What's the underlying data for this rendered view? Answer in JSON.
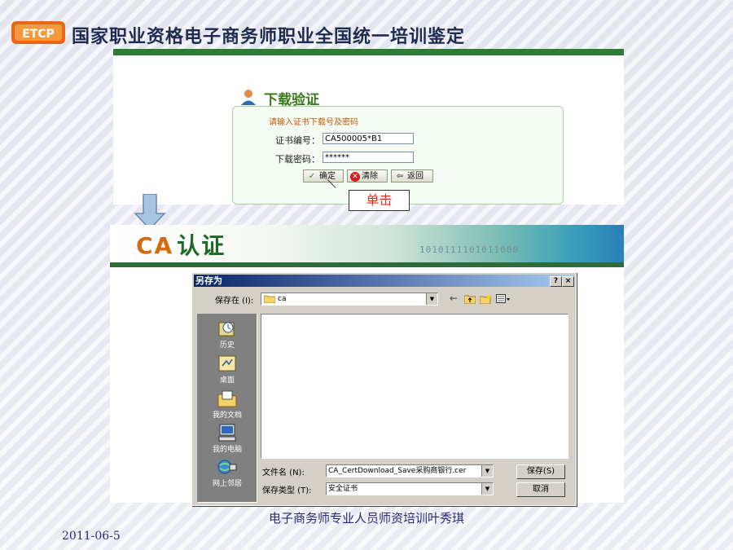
{
  "header": {
    "logo_text": "ETCP",
    "title": "国家职业资格电子商务师职业全国统一培训鉴定"
  },
  "download_panel": {
    "title": "下载验证",
    "hint": "请输入证书下载号及密码",
    "cert_label": "证书编号：",
    "cert_value": "CA500005*B1",
    "pwd_label": "下载密码：",
    "pwd_value": "******",
    "confirm_label": "确定",
    "clear_label": "清除",
    "back_label": "返回"
  },
  "callout": "单击",
  "ca_banner": {
    "brand": "CA",
    "brand_cn": "认证",
    "binary": "1010111101011000"
  },
  "save_dialog": {
    "title": "另存为",
    "help_btn": "?",
    "close_btn": "×",
    "save_in_label": "保存在 (I):",
    "save_in_value": "ca",
    "places": [
      "历史",
      "桌面",
      "我的文档",
      "我的电脑",
      "网上邻居"
    ],
    "filename_label": "文件名 (N):",
    "filename_value": "CA_CertDownload_Save采购商银行.cer",
    "filetype_label": "保存类型 (T):",
    "filetype_value": "安全证书",
    "save_button": "保存(S)",
    "cancel_button": "取消"
  },
  "footer": {
    "date": "2011-06-5",
    "text": "电子商务师专业人员师资培训叶秀琪"
  },
  "colors": {
    "header_title": "#1e2a4f",
    "green_bar": "#2e7d36",
    "dialog_title": "#0a246a",
    "callout_text": "#e03020",
    "footer_text": "#2a2a7a"
  }
}
